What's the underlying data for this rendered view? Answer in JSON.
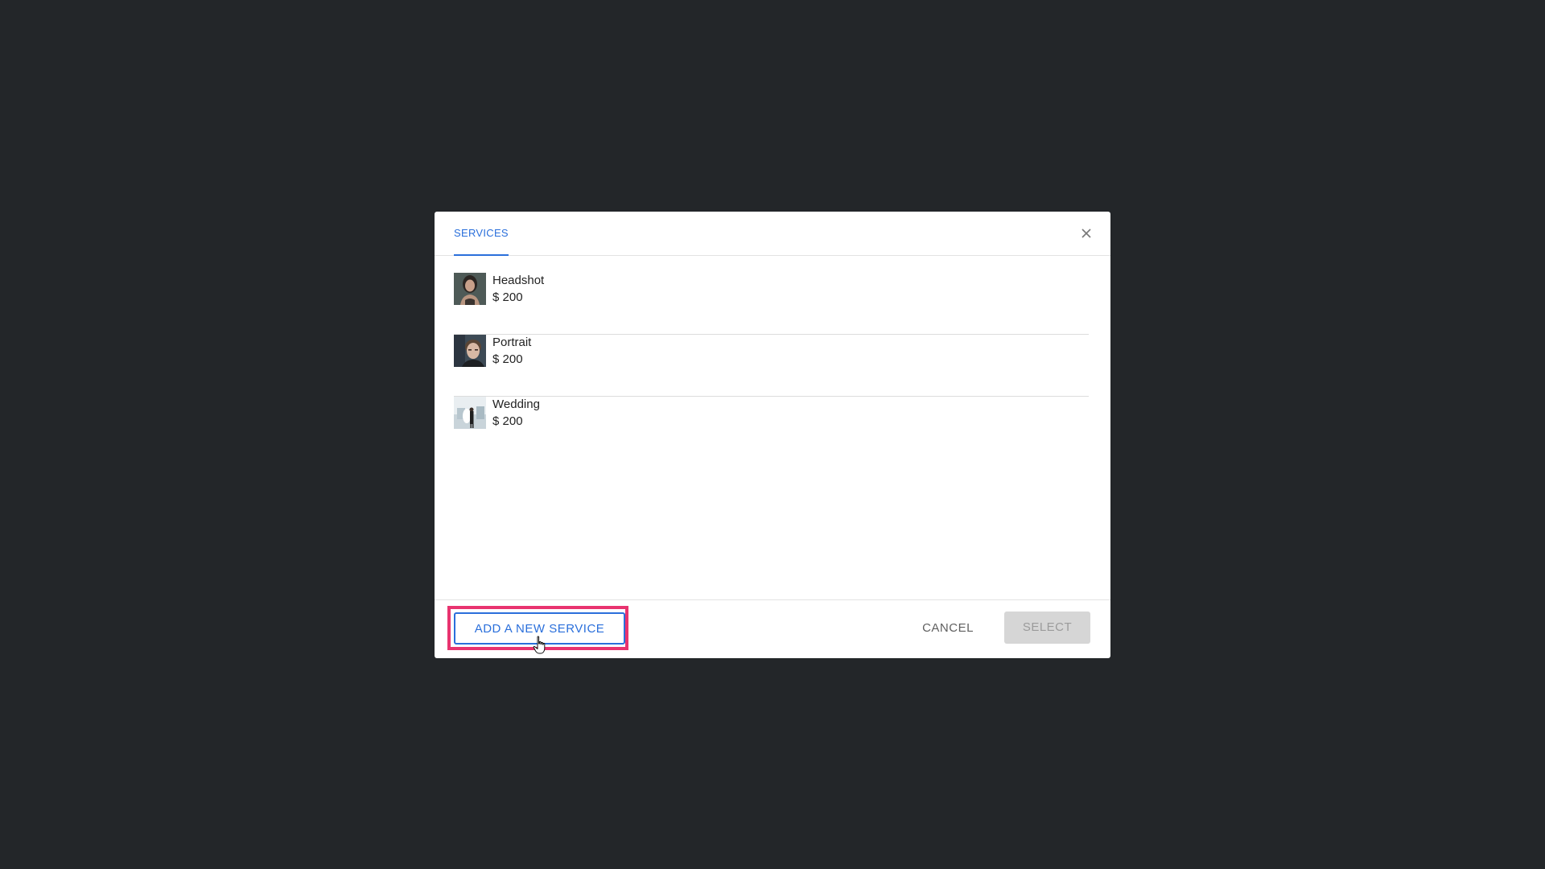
{
  "dialog": {
    "tab_label": "SERVICES",
    "close_icon": "close-icon"
  },
  "services": [
    {
      "name": "Headshot",
      "price": "$ 200",
      "thumb": "headshot-thumbnail"
    },
    {
      "name": "Portrait",
      "price": "$ 200",
      "thumb": "portrait-thumbnail"
    },
    {
      "name": "Wedding",
      "price": "$ 200",
      "thumb": "wedding-thumbnail"
    }
  ],
  "footer": {
    "add_label": "ADD A NEW SERVICE",
    "cancel_label": "CANCEL",
    "select_label": "SELECT",
    "select_state": "disabled"
  },
  "colors": {
    "backdrop": "#232629",
    "accent": "#2a6fdb",
    "highlight": "#e8336f",
    "disabled_bg": "#d6d6d6",
    "disabled_text": "#9b9b9b"
  }
}
